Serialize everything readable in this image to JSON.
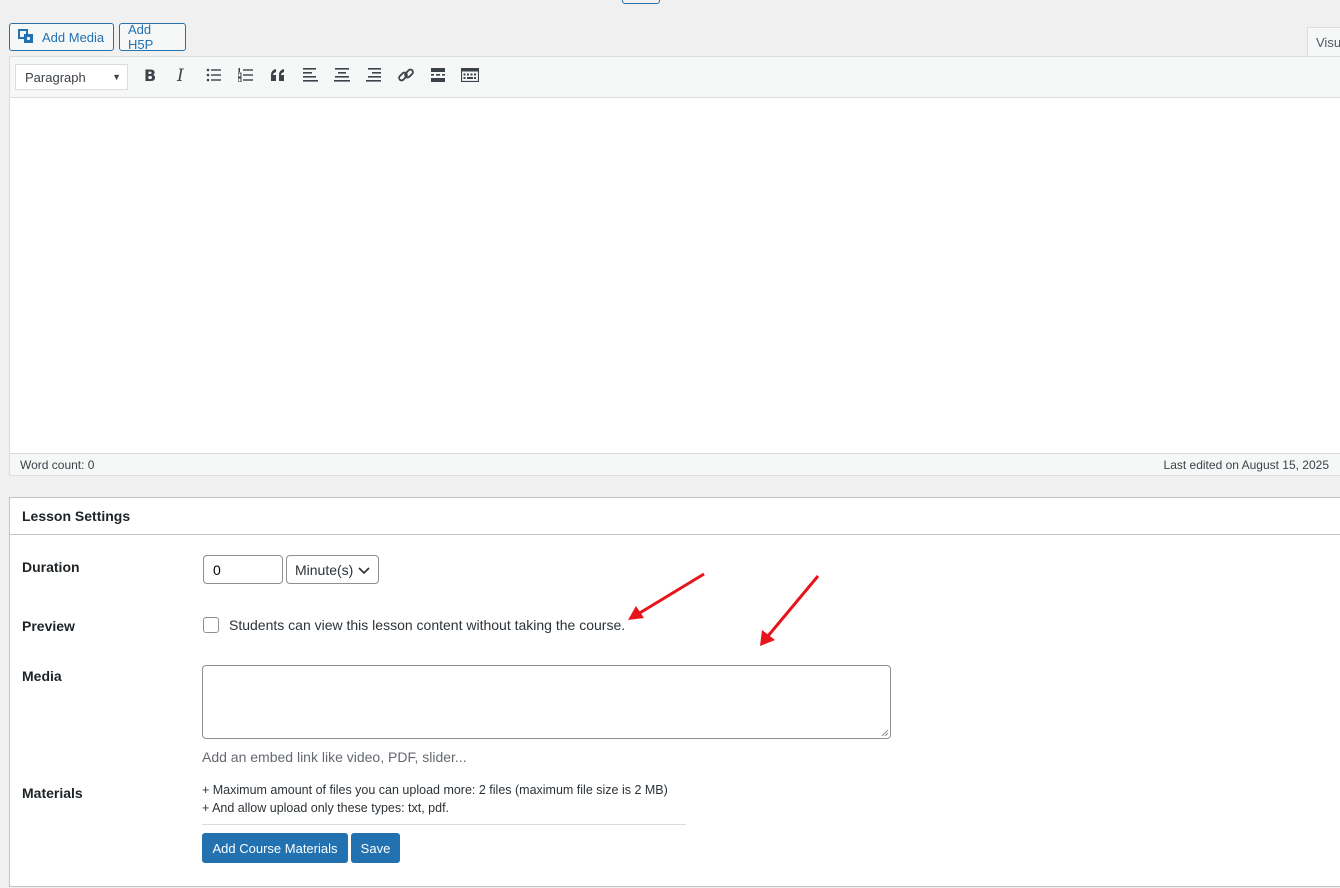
{
  "media_buttons": {
    "add_media": "Add Media",
    "add_h5p": "Add H5P"
  },
  "editor": {
    "visual_tab": "Visu",
    "format_select": "Paragraph",
    "toolbar_icons": [
      "bold-icon",
      "italic-icon",
      "bulleted-list-icon",
      "numbered-list-icon",
      "blockquote-icon",
      "align-left-icon",
      "align-center-icon",
      "align-right-icon",
      "link-icon",
      "read-more-icon",
      "toolbar-toggle-icon"
    ],
    "word_count": "Word count: 0",
    "last_edited": "Last edited on August 15, 2025"
  },
  "lesson_settings": {
    "title": "Lesson Settings",
    "duration": {
      "label": "Duration",
      "value": "0",
      "unit": "Minute(s)"
    },
    "preview": {
      "label": "Preview",
      "checked": false,
      "text": "Students can view this lesson content without taking the course."
    },
    "media": {
      "label": "Media",
      "value": "",
      "description": "Add an embed link like video, PDF, slider..."
    },
    "materials": {
      "label": "Materials",
      "info_1": "+ Maximum amount of files you can upload more: 2 files (maximum file size is 2 MB)",
      "info_2": "+ And allow upload only these types: txt, pdf.",
      "add_button": "Add Course Materials",
      "save_button": "Save"
    }
  },
  "colors": {
    "accent": "#2271b1",
    "annotation_arrow": "#e8141b"
  }
}
